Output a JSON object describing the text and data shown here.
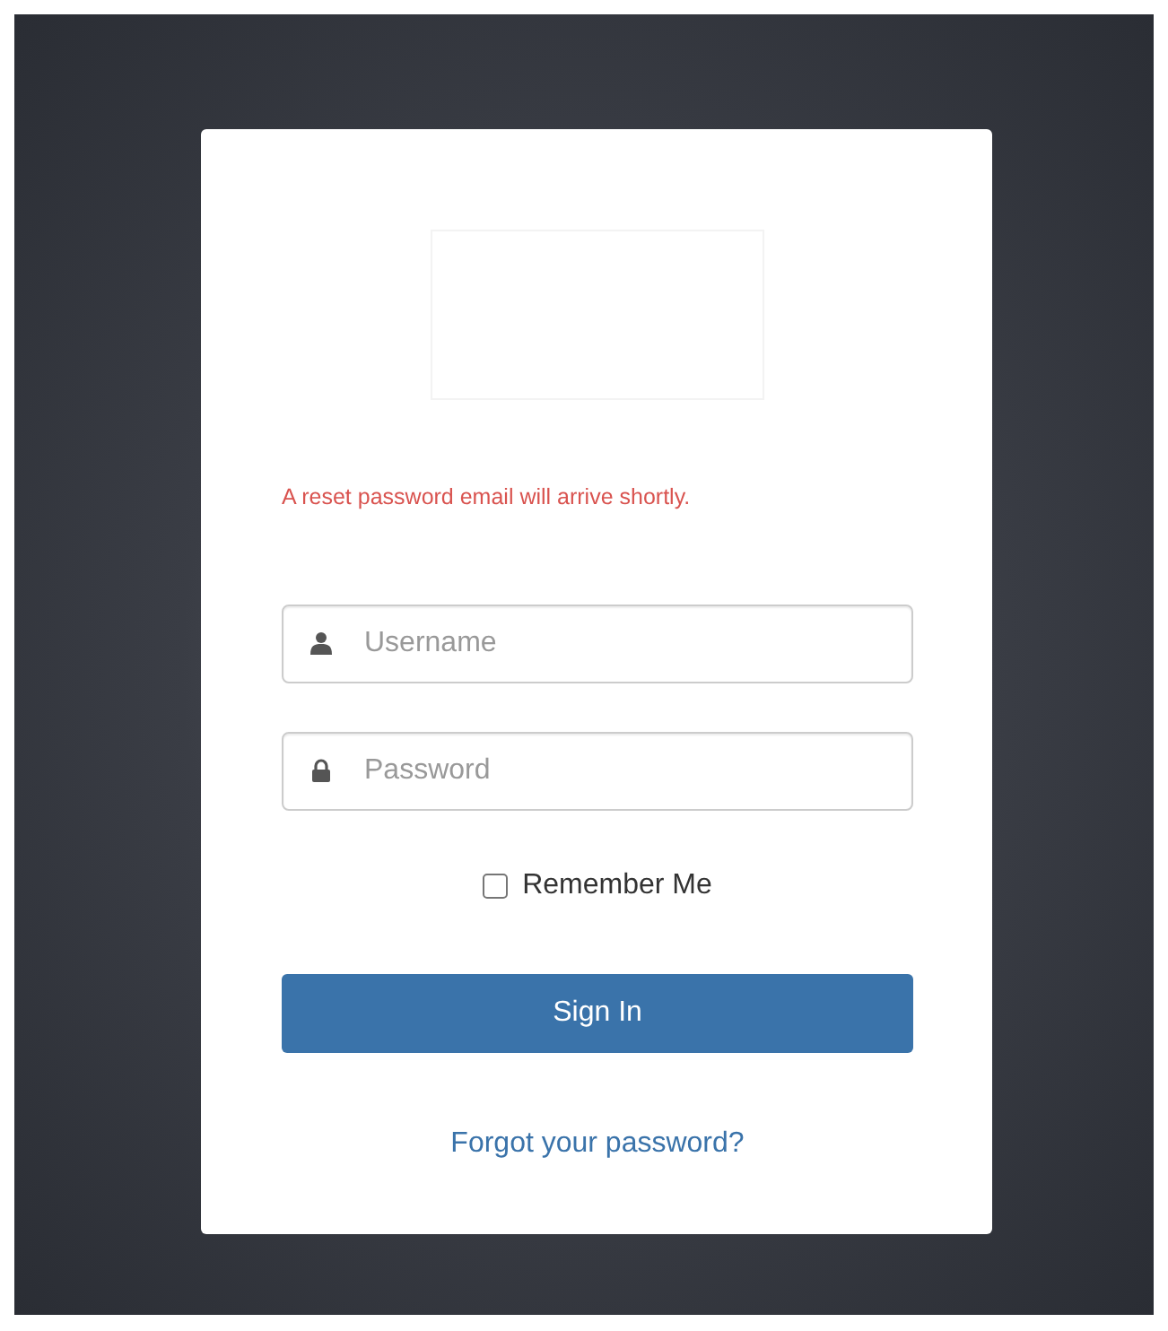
{
  "message": "A reset password email will arrive shortly.",
  "fields": [
    {
      "kind": "user",
      "placeholder": "Username"
    },
    {
      "kind": "lock",
      "placeholder": "Password"
    }
  ],
  "remember": {
    "label": "Remember Me",
    "checked": false
  },
  "submit": "Sign In",
  "forgot_link": "Forgot your password?"
}
